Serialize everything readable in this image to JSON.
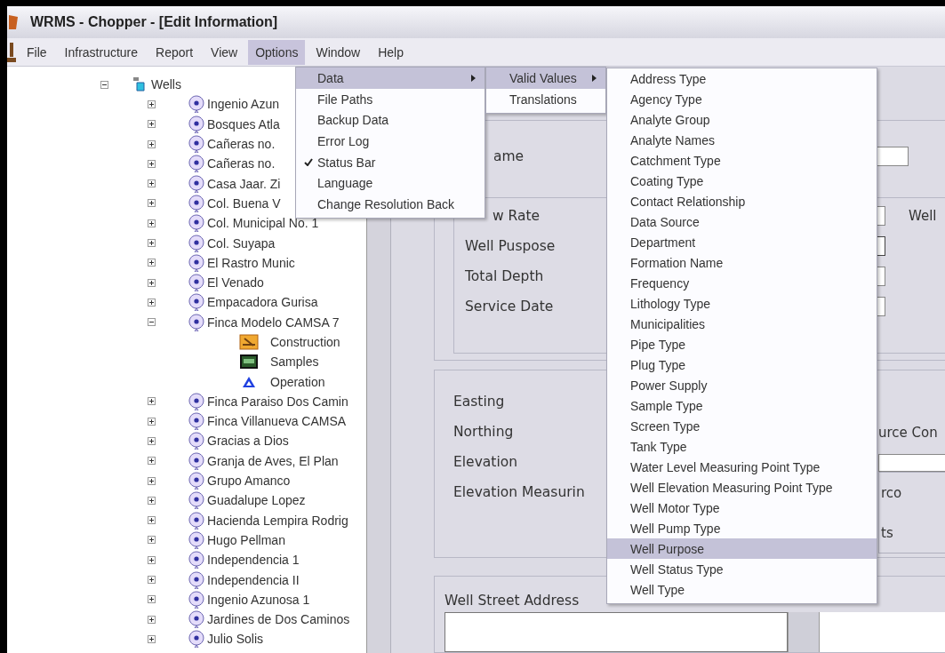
{
  "window": {
    "title": "WRMS - Chopper - [Edit Information]"
  },
  "menubar": [
    {
      "label": "File",
      "selected": false
    },
    {
      "label": "Infrastructure",
      "selected": false
    },
    {
      "label": "Report",
      "selected": false
    },
    {
      "label": "View",
      "selected": false
    },
    {
      "label": "Options",
      "selected": true
    },
    {
      "label": "Window",
      "selected": false
    },
    {
      "label": "Help",
      "selected": false
    }
  ],
  "tree": {
    "label": "Wells",
    "expanded": true,
    "children": [
      {
        "label": "Ingenio Azun",
        "kind": "well",
        "expanded": false
      },
      {
        "label": "Bosques Atla",
        "kind": "well",
        "expanded": false
      },
      {
        "label": "Cañeras no.",
        "kind": "well",
        "expanded": false
      },
      {
        "label": "Cañeras no.",
        "kind": "well",
        "expanded": false
      },
      {
        "label": "Casa Jaar. Zi",
        "kind": "well",
        "expanded": false
      },
      {
        "label": "Col. Buena V",
        "kind": "well",
        "expanded": false
      },
      {
        "label": "Col. Municipal No. 1",
        "kind": "well",
        "expanded": false
      },
      {
        "label": "Col. Suyapa",
        "kind": "well",
        "expanded": false
      },
      {
        "label": "El Rastro Munic",
        "kind": "well",
        "expanded": false
      },
      {
        "label": "El Venado",
        "kind": "well",
        "expanded": false
      },
      {
        "label": "Empacadora Gurisa",
        "kind": "well",
        "expanded": false
      },
      {
        "label": "Finca Modelo CAMSA 7",
        "kind": "well",
        "expanded": true,
        "children": [
          {
            "label": "Construction",
            "kind": "construction"
          },
          {
            "label": "Samples",
            "kind": "samples"
          },
          {
            "label": "Operation",
            "kind": "operation"
          }
        ]
      },
      {
        "label": "Finca Paraiso Dos Camin",
        "kind": "well",
        "expanded": false
      },
      {
        "label": "Finca Villanueva CAMSA",
        "kind": "well",
        "expanded": false
      },
      {
        "label": "Gracias a Dios",
        "kind": "well",
        "expanded": false
      },
      {
        "label": "Granja de Aves, El Plan",
        "kind": "well",
        "expanded": false
      },
      {
        "label": "Grupo Amanco",
        "kind": "well",
        "expanded": false
      },
      {
        "label": "Guadalupe Lopez",
        "kind": "well",
        "expanded": false
      },
      {
        "label": "Hacienda Lempira Rodrig",
        "kind": "well",
        "expanded": false
      },
      {
        "label": "Hugo Pellman",
        "kind": "well",
        "expanded": false
      },
      {
        "label": "Independencia 1",
        "kind": "well",
        "expanded": false
      },
      {
        "label": "Independencia II",
        "kind": "well",
        "expanded": false
      },
      {
        "label": "Ingenio Azunosa 1",
        "kind": "well",
        "expanded": false
      },
      {
        "label": "Jardines de Dos Caminos",
        "kind": "well",
        "expanded": false
      },
      {
        "label": "Julio Solis",
        "kind": "well",
        "expanded": false
      }
    ]
  },
  "form": {
    "name_label": "ame",
    "details": [
      "w Rate",
      "Well Puspose",
      "Total Depth",
      "Service Date"
    ],
    "details_right": "Well",
    "location": [
      "Easting",
      "Northing",
      "Elevation",
      "Elevation Measurin"
    ],
    "location_right": [
      "urce Con",
      "rco",
      "ts"
    ],
    "address_label": "Well Street Address"
  },
  "options_menu": [
    {
      "label": "Data",
      "checked": false,
      "submenu": true,
      "selected": true
    },
    {
      "label": "File Paths",
      "checked": false,
      "submenu": false,
      "selected": false
    },
    {
      "label": "Backup Data",
      "checked": false,
      "submenu": false,
      "selected": false
    },
    {
      "label": "Error Log",
      "checked": false,
      "submenu": false,
      "selected": false
    },
    {
      "label": "Status Bar",
      "checked": true,
      "submenu": false,
      "selected": false
    },
    {
      "label": "Language",
      "checked": false,
      "submenu": false,
      "selected": false
    },
    {
      "label": "Change Resolution Back",
      "checked": false,
      "submenu": false,
      "selected": false
    }
  ],
  "data_submenu": [
    {
      "label": "Valid Values",
      "submenu": true,
      "selected": true
    },
    {
      "label": "Translations",
      "submenu": false,
      "selected": false
    }
  ],
  "valid_values_menu": [
    {
      "label": "Address Type",
      "selected": false
    },
    {
      "label": "Agency Type",
      "selected": false
    },
    {
      "label": "Analyte Group",
      "selected": false
    },
    {
      "label": "Analyte Names",
      "selected": false
    },
    {
      "label": "Catchment Type",
      "selected": false
    },
    {
      "label": "Coating Type",
      "selected": false
    },
    {
      "label": "Contact Relationship",
      "selected": false
    },
    {
      "label": "Data Source",
      "selected": false
    },
    {
      "label": "Department",
      "selected": false
    },
    {
      "label": "Formation Name",
      "selected": false
    },
    {
      "label": "Frequency",
      "selected": false
    },
    {
      "label": "Lithology Type",
      "selected": false
    },
    {
      "label": "Municipalities",
      "selected": false
    },
    {
      "label": "Pipe Type",
      "selected": false
    },
    {
      "label": "Plug Type",
      "selected": false
    },
    {
      "label": "Power Supply",
      "selected": false
    },
    {
      "label": "Sample Type",
      "selected": false
    },
    {
      "label": "Screen Type",
      "selected": false
    },
    {
      "label": "Tank Type",
      "selected": false
    },
    {
      "label": "Water Level Measuring Point Type",
      "selected": false
    },
    {
      "label": "Well Elevation Measuring Point Type",
      "selected": false
    },
    {
      "label": "Well Motor Type",
      "selected": false
    },
    {
      "label": "Well Pump Type",
      "selected": false
    },
    {
      "label": "Well Purpose",
      "selected": true
    },
    {
      "label": "Well Status Type",
      "selected": false
    },
    {
      "label": "Well Type",
      "selected": false
    }
  ]
}
